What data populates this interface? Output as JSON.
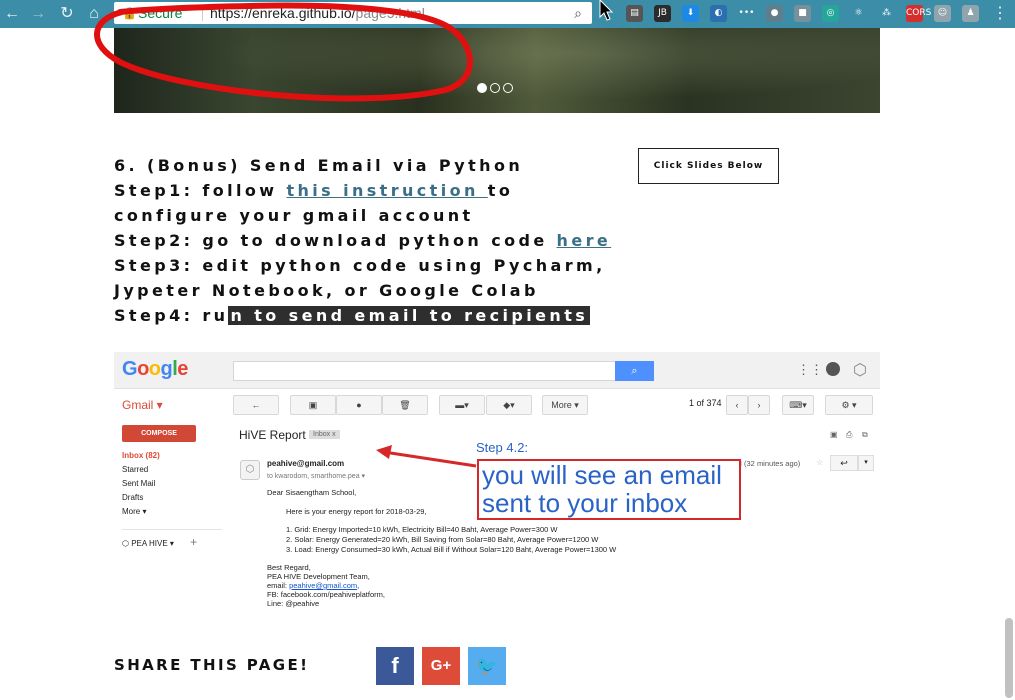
{
  "browser": {
    "secure_label": "Secure",
    "url_base": "https://enreka.github.io/",
    "url_path": "page5.html",
    "nav": {
      "back": "←",
      "forward": "→",
      "reload": "↻",
      "home": "⌂"
    },
    "extensions": [
      {
        "icon": "ext-book-icon",
        "text": "▤",
        "color": "#555555"
      },
      {
        "icon": "ext-jb-icon",
        "text": "JB",
        "color": "#2b2b2b"
      },
      {
        "icon": "ext-download-icon",
        "text": "⬇",
        "color": "#1e88e5"
      },
      {
        "icon": "ext-wave-icon",
        "text": "◐",
        "color": "#2a6fb0"
      },
      {
        "icon": "ext-dots-icon",
        "text": "•••",
        "color": "#3c8ea8"
      },
      {
        "icon": "ext-circle-icon",
        "text": "●",
        "color": "#607d8b"
      },
      {
        "icon": "ext-box-icon",
        "text": "■",
        "color": "#78909c"
      },
      {
        "icon": "ext-spiral-icon",
        "text": "◎",
        "color": "#26a69a"
      },
      {
        "icon": "ext-react-icon",
        "text": "⚛",
        "color": "#3c8ea8"
      },
      {
        "icon": "ext-nodes-icon",
        "text": "⁂",
        "color": "#3c8ea8"
      },
      {
        "icon": "ext-cors-icon",
        "text": "CORS",
        "color": "#d32f2f"
      },
      {
        "icon": "ext-ghost-icon",
        "text": "☺",
        "color": "#90a4ae"
      },
      {
        "icon": "ext-shirt-icon",
        "text": "♟",
        "color": "#90a4ae"
      }
    ],
    "menu_icon": "⋮"
  },
  "hero": {
    "dots": [
      true,
      false,
      false
    ]
  },
  "steps": {
    "line1": "6. (Bonus) Send Email via Python",
    "step1_prefix": "Step1: follow ",
    "step1_link": "this instruction ",
    "step1_suffix": " to configure your gmail account",
    "step2_prefix": "Step2: go to download python code ",
    "step2_link": "here ",
    "step3": "Step3: edit python code using Pycharm, Jypeter Notebook, or Google Colab",
    "step4_prefix": "Step4: ru",
    "step4_highlight": "n to send email to recipients"
  },
  "slides_button": "Click Slides Below",
  "gmail": {
    "logo_letters": [
      {
        "c": "G",
        "color": "#4285f4"
      },
      {
        "c": "o",
        "color": "#ea4335"
      },
      {
        "c": "o",
        "color": "#fbbc05"
      },
      {
        "c": "g",
        "color": "#4285f4"
      },
      {
        "c": "l",
        "color": "#34a853"
      },
      {
        "c": "e",
        "color": "#ea4335"
      }
    ],
    "label": "Gmail ▾",
    "search_icon": "⌕",
    "more_btn": "More ▾",
    "count": "1 of 374",
    "compose": "COMPOSE",
    "sidebar": [
      "Inbox (82)",
      "Starred",
      "Sent Mail",
      "Drafts",
      "More ▾"
    ],
    "account": "PEA HIVE ▾",
    "subject": "HiVE Report",
    "tag": "Inbox x",
    "sender": "peahive@gmail.com",
    "to": "to kwarodom, smarthome.pea ▾",
    "time": "1:42 PM (32 minutes ago)",
    "greeting": "Dear Sisaengtham School,",
    "intro": "Here is your energy report for 2018-03-29,",
    "items": [
      "1. Grid: Energy Imported=10 kWh, Electricity Bill=40 Baht, Average Power=300 W",
      "2. Solar: Energy Generated=20 kWh, Bill Saving from Solar=80 Baht, Average Power=1200 W",
      "3. Load: Energy Consumed=30 kWh, Actual Bill if Without Solar=120 Baht, Average Power=1300 W"
    ],
    "sign": [
      "Best Regard,",
      "PEA HIVE Development Team,"
    ],
    "email_prefix": "email: ",
    "email_link": "peahive@gmail.com",
    "email_suffix": ",",
    "fb": "FB: facebook.com/peahiveplatform,",
    "line": "Line: @peahive"
  },
  "annotation": {
    "step": "Step 4.2:",
    "line1": "you will see an email",
    "line2": "sent to your inbox",
    "color": "#d62828"
  },
  "share": {
    "title": "SHARE THIS PAGE!",
    "buttons": [
      {
        "name": "facebook",
        "glyph": "f",
        "color": "#3b5998"
      },
      {
        "name": "google-plus",
        "glyph": "G+",
        "color": "#dd4b39"
      },
      {
        "name": "twitter",
        "glyph": "🐦",
        "color": "#55acee"
      }
    ]
  }
}
